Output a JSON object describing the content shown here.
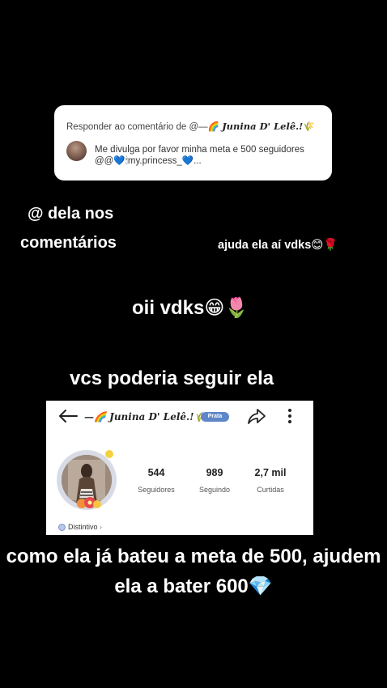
{
  "reply_card": {
    "prefix": "Responder ao comentário de @—",
    "emoji1": "🌈",
    "name": "Junina D' Lelê.!",
    "emoji2": "🌾",
    "comment_line1": "Me divulga por favor minha meta e 500 seguidores",
    "comment_line2": "@@💙🕯my.princess_💙..."
  },
  "captions": {
    "dela": "@ dela nos",
    "comentarios": "comentários",
    "ajuda": "ajuda ela aí vdks😊🌹",
    "oii": "oii vdks😁🌷",
    "vcs": "vcs poderia seguir ela",
    "como": "como ela já bateu a meta de 500, ajudem ela a bater 600💎"
  },
  "profile": {
    "name_prefix": "—🌈",
    "name": "Junina D' Lelê.!",
    "name_suffix": "🌾",
    "badge": "Prata",
    "stats": [
      {
        "value": "544",
        "label": "Seguidores"
      },
      {
        "value": "989",
        "label": "Seguindo"
      },
      {
        "value": "2,7 mil",
        "label": "Curtidas"
      }
    ],
    "distintivo": "Distintivo",
    "distintivo_chevron": "›",
    "icons": [
      "back-arrow-icon",
      "share-icon",
      "more-vertical-icon"
    ]
  }
}
